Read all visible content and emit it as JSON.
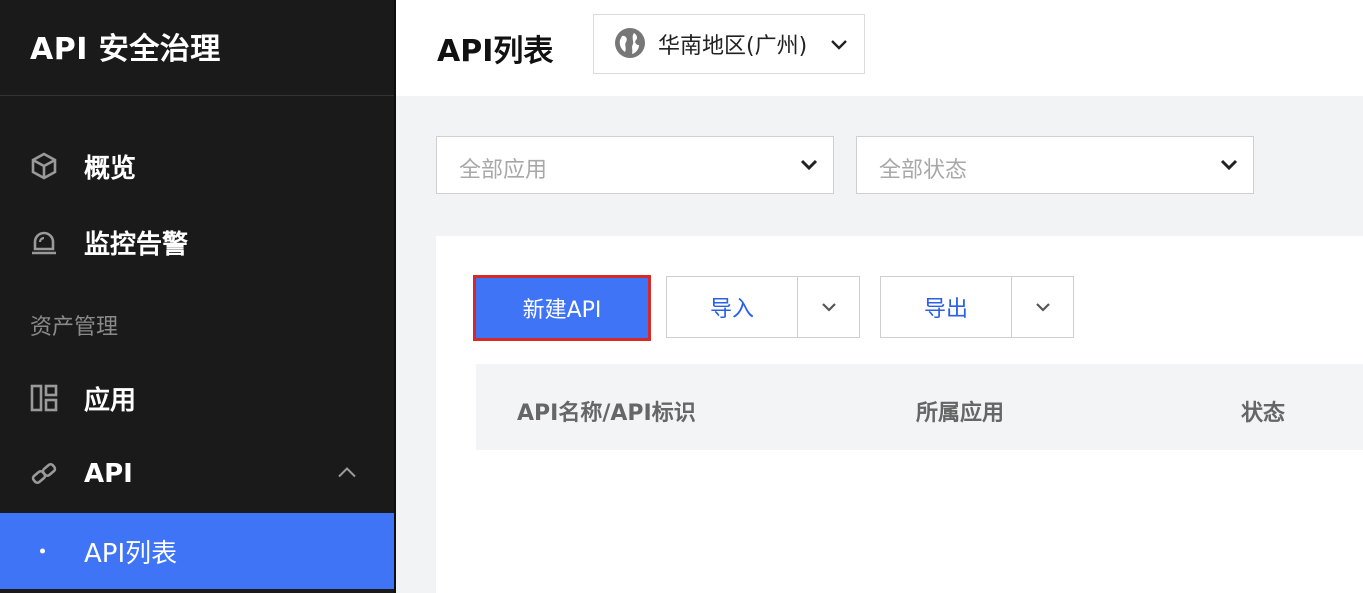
{
  "sidebar": {
    "brand": "API 安全治理",
    "items": [
      {
        "label": "概览",
        "icon": "cube-icon"
      },
      {
        "label": "监控告警",
        "icon": "alarm-icon"
      }
    ],
    "section_title": "资产管理",
    "asset_items": [
      {
        "label": "应用",
        "icon": "dashboard-icon"
      },
      {
        "label": "API",
        "icon": "link-icon",
        "expanded": true
      }
    ],
    "sub_items": [
      {
        "label": "API列表",
        "active": true
      }
    ]
  },
  "header": {
    "title": "API列表",
    "region": "华南地区(广州)",
    "region_icon": "globe-icon"
  },
  "filters": {
    "app_placeholder": "全部应用",
    "status_placeholder": "全部状态"
  },
  "toolbar": {
    "new_api": "新建API",
    "import": "导入",
    "export": "导出"
  },
  "table": {
    "columns": [
      "API名称/API标识",
      "所属应用",
      "状态"
    ]
  },
  "colors": {
    "sidebar_bg": "#1a1a1a",
    "accent": "#3f74f6",
    "highlight_border": "#d52a2a"
  }
}
